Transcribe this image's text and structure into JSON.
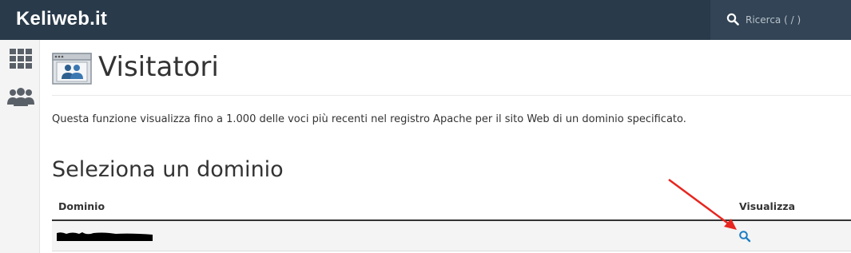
{
  "header": {
    "brand": "Keliweb.it",
    "search": {
      "placeholder": "Ricerca ( / )",
      "value": ""
    }
  },
  "sidebar": {
    "items": [
      {
        "icon": "apps-grid-icon"
      },
      {
        "icon": "users-icon"
      }
    ]
  },
  "page": {
    "title": "Visitatori",
    "description": "Questa funzione visualizza fino a 1.000 delle voci più recenti nel registro Apache per il sito Web di un dominio specificato.",
    "section_title": "Seleziona un dominio",
    "table": {
      "columns": [
        "Dominio",
        "Visualizza"
      ],
      "rows": [
        {
          "domain": "[redacted]",
          "action_icon": "search-icon"
        }
      ]
    }
  },
  "colors": {
    "topbar": "#293a4a",
    "search_bg": "#324455",
    "link_blue": "#1a7dc4",
    "annotation_arrow": "#e8251f"
  }
}
